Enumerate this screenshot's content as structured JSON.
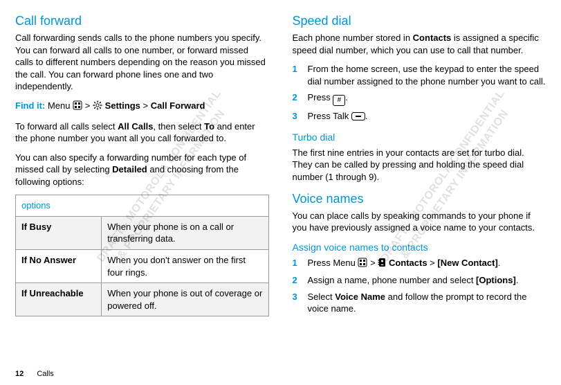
{
  "watermark": {
    "line1": "DRAFT - MOTOROLA CONFIDENTIAL",
    "line2": "& PROPRIETARY INFORMATION"
  },
  "left": {
    "heading": "Call forward",
    "intro": "Call forwarding sends calls to the phone numbers you specify. You can forward all calls to one number, or forward missed calls to different numbers depending on the reason you missed the call. You can forward phone lines one and two independently.",
    "findit_label": "Find it:",
    "findit_parts": {
      "menu": "Menu",
      "gt1": ">",
      "settings": "Settings",
      "gt2": ">",
      "callforward": "Call Forward"
    },
    "para2_a": "To forward all calls select ",
    "para2_b": "All Calls",
    "para2_c": ", then select ",
    "para2_d": "To",
    "para2_e": " and enter the phone number you want all you call forwarded to.",
    "para3_a": "You can also specify a forwarding number for each type of missed call by selecting ",
    "para3_b": "Detailed",
    "para3_c": " and choosing from the following options:",
    "table": {
      "header": "options",
      "rows": [
        {
          "label": "If Busy",
          "desc": "When your phone is on a call or transferring data."
        },
        {
          "label": "If No Answer",
          "desc": "When you don't answer on the first four rings."
        },
        {
          "label": "If Unreachable",
          "desc": "When your phone is out of coverage or powered off."
        }
      ]
    }
  },
  "right": {
    "speeddial": {
      "heading": "Speed dial",
      "intro_a": "Each phone number stored in ",
      "intro_b": "Contacts",
      "intro_c": " is assigned a specific speed dial number, which you can use to call that number.",
      "steps": [
        {
          "n": "1",
          "text": "From the home screen, use the keypad to enter the speed dial number assigned to the phone number you want to call."
        },
        {
          "n": "2",
          "pre": "Press ",
          "key": "#",
          "post": "."
        },
        {
          "n": "3",
          "pre": "Press Talk ",
          "talk": true,
          "post": "."
        }
      ]
    },
    "turbo": {
      "heading": "Turbo dial",
      "text": "The first nine entries in your contacts are set for turbo dial. They can be called by pressing and holding the speed dial number (1 through 9)."
    },
    "voicenames": {
      "heading": "Voice names",
      "intro": "You can place calls by speaking commands to your phone if you have previously assigned a voice name to your contacts.",
      "assign_heading": "Assign voice names to contacts",
      "steps": [
        {
          "n": "1",
          "pre": "Press Menu ",
          "menu": true,
          "gt": " > ",
          "contacts_icon": true,
          "contacts": "Contacts",
          "gt2": " > ",
          "newc": "[New Contact]",
          "post": "."
        },
        {
          "n": "2",
          "pre": "Assign a name, phone number and select ",
          "opt": "[Options]",
          "post": "."
        },
        {
          "n": "3",
          "pre": "Select ",
          "vn": "Voice Name",
          "post": " and follow the prompt to record the voice name."
        }
      ]
    }
  },
  "footer": {
    "page": "12",
    "section": "Calls"
  }
}
